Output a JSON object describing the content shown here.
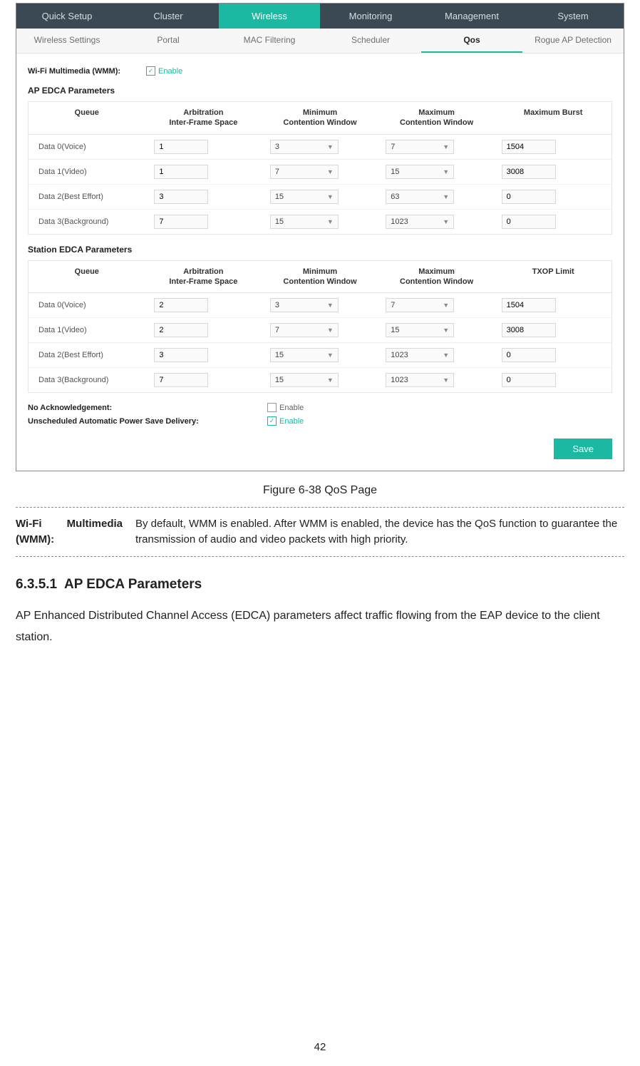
{
  "mainTabs": [
    "Quick Setup",
    "Cluster",
    "Wireless",
    "Monitoring",
    "Management",
    "System"
  ],
  "mainActive": 2,
  "subTabs": [
    "Wireless Settings",
    "Portal",
    "MAC Filtering",
    "Scheduler",
    "Qos",
    "Rogue AP Detection"
  ],
  "subActive": 4,
  "wmm": {
    "label": "Wi-Fi Multimedia (WMM):",
    "enable": "Enable",
    "checked": true
  },
  "ap": {
    "title": "AP EDCA Parameters",
    "headers": [
      "Queue",
      "Arbitration\nInter-Frame Space",
      "Minimum\nContention Window",
      "Maximum\nContention Window",
      "Maximum Burst"
    ],
    "rows": [
      {
        "q": "Data 0(Voice)",
        "aifs": "1",
        "min": "3",
        "max": "7",
        "last": "1504"
      },
      {
        "q": "Data 1(Video)",
        "aifs": "1",
        "min": "7",
        "max": "15",
        "last": "3008"
      },
      {
        "q": "Data 2(Best Effort)",
        "aifs": "3",
        "min": "15",
        "max": "63",
        "last": "0"
      },
      {
        "q": "Data 3(Background)",
        "aifs": "7",
        "min": "15",
        "max": "1023",
        "last": "0"
      }
    ]
  },
  "sta": {
    "title": "Station EDCA Parameters",
    "headers": [
      "Queue",
      "Arbitration\nInter-Frame Space",
      "Minimum\nContention Window",
      "Maximum\nContention Window",
      "TXOP Limit"
    ],
    "rows": [
      {
        "q": "Data 0(Voice)",
        "aifs": "2",
        "min": "3",
        "max": "7",
        "last": "1504"
      },
      {
        "q": "Data 1(Video)",
        "aifs": "2",
        "min": "7",
        "max": "15",
        "last": "3008"
      },
      {
        "q": "Data 2(Best Effort)",
        "aifs": "3",
        "min": "15",
        "max": "1023",
        "last": "0"
      },
      {
        "q": "Data 3(Background)",
        "aifs": "7",
        "min": "15",
        "max": "1023",
        "last": "0"
      }
    ]
  },
  "noAck": {
    "label": "No Acknowledgement:",
    "enable": "Enable",
    "checked": false
  },
  "uapsd": {
    "label": "Unscheduled Automatic Power Save Delivery:",
    "enable": "Enable",
    "checked": true
  },
  "save": "Save",
  "figcap": "Figure 6-38 QoS Page",
  "desc": {
    "term": "Wi-Fi Multimedia (WMM):",
    "text": "By default, WMM is enabled. After WMM is enabled, the device has the QoS function to guarantee the transmission of audio and video packets with high priority."
  },
  "section": {
    "num": "6.3.5.1",
    "title": "AP EDCA Parameters"
  },
  "para": "AP Enhanced Distributed Channel Access (EDCA) parameters affect traffic flowing from the EAP device to the client station.",
  "pageNum": "42"
}
